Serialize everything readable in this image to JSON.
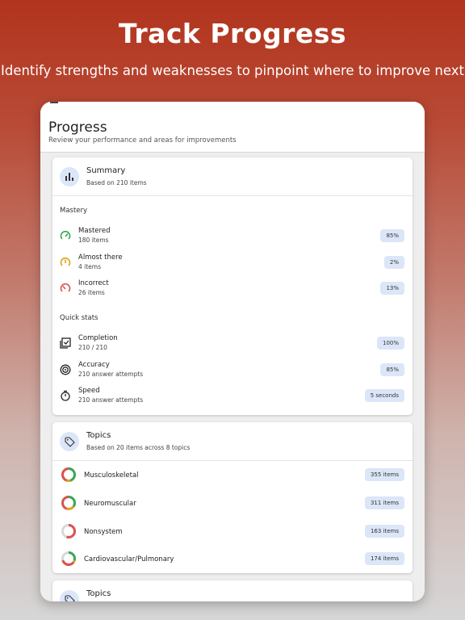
{
  "hero": {
    "title": "Track Progress",
    "subtitle": "Identify strengths and weaknesses to pinpoint where to improve next"
  },
  "header": {
    "title": "Progress",
    "subtitle": "Review your performance and areas for improvements"
  },
  "summary": {
    "title": "Summary",
    "subtitle": "Based on 210 items",
    "mastery_label": "Mastery",
    "mastery": [
      {
        "label": "Mastered",
        "sub": "180 items",
        "value": "85%",
        "icon": "gauge-high-icon",
        "color": "#3aa657"
      },
      {
        "label": "Almost there",
        "sub": "4 items",
        "value": "2%",
        "icon": "gauge-mid-icon",
        "color": "#e0a21a"
      },
      {
        "label": "Incorrect",
        "sub": "26 items",
        "value": "13%",
        "icon": "gauge-low-icon",
        "color": "#d9534f"
      }
    ],
    "quick_label": "Quick stats",
    "quick": [
      {
        "label": "Completion",
        "sub": "210 / 210",
        "value": "100%",
        "icon": "checklist-icon"
      },
      {
        "label": "Accuracy",
        "sub": "210 answer attempts",
        "value": "85%",
        "icon": "target-icon"
      },
      {
        "label": "Speed",
        "sub": "210 answer attempts",
        "value": "5 seconds",
        "icon": "stopwatch-icon"
      }
    ]
  },
  "topics": {
    "title": "Topics",
    "subtitle": "Based on 20 items across 8 topics",
    "items": [
      {
        "label": "Musculoskeletal",
        "value": "355 items",
        "segments": [
          0.45,
          0.1,
          0.45
        ]
      },
      {
        "label": "Neuromuscular",
        "value": "311 items",
        "segments": [
          0.35,
          0.2,
          0.45
        ]
      },
      {
        "label": "Nonsystem",
        "value": "163 items",
        "segments": [
          0.0,
          0.0,
          0.55
        ]
      },
      {
        "label": "Cardiovascular/Pulmonary",
        "value": "174 items",
        "segments": [
          0.3,
          0.05,
          0.35
        ]
      }
    ]
  },
  "topics2": {
    "title": "Topics"
  },
  "colors": {
    "accent": "#dbe6f8",
    "green": "#3aa657",
    "yellow": "#e0a21a",
    "red": "#d9534f",
    "track": "#d8d8d8"
  }
}
